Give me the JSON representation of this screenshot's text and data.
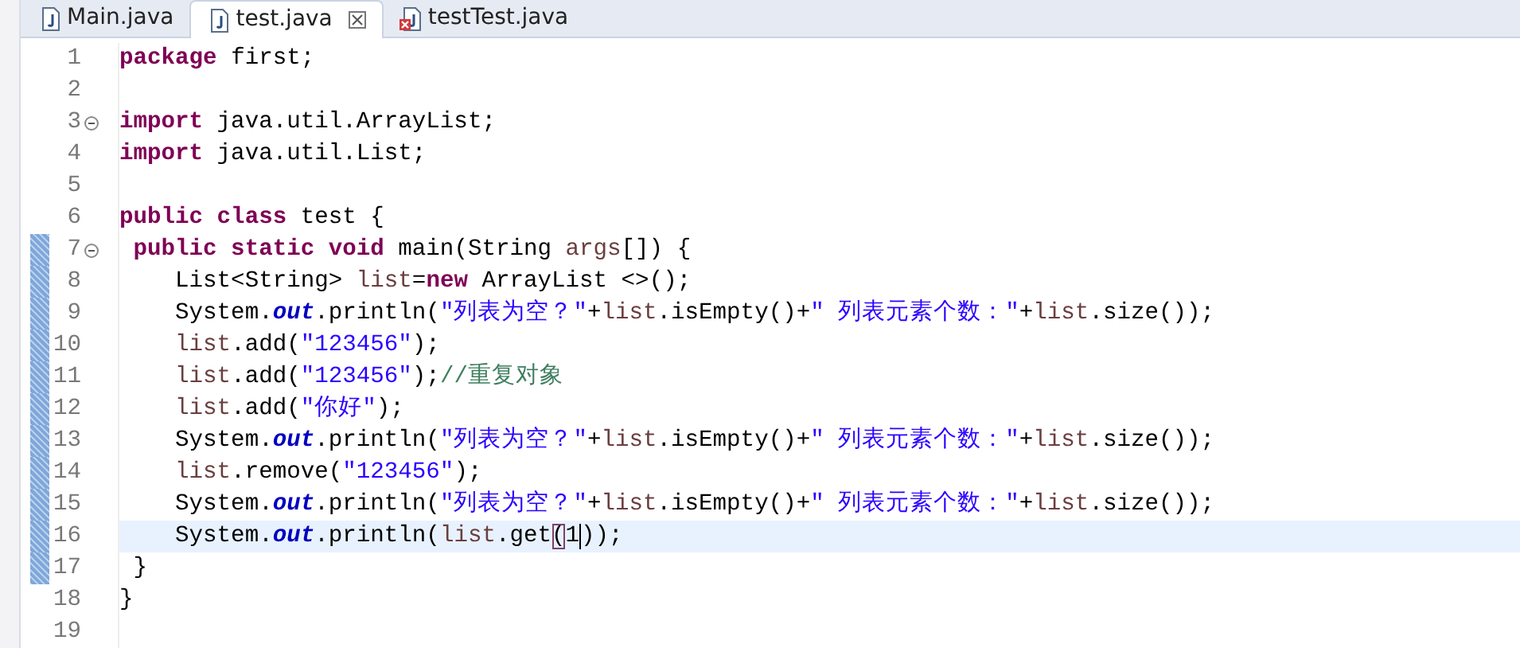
{
  "tabs": [
    {
      "label": "Main.java",
      "selected": false,
      "closable": false,
      "error": false
    },
    {
      "label": "test.java",
      "selected": true,
      "closable": true,
      "error": false
    },
    {
      "label": "testTest.java",
      "selected": false,
      "closable": false,
      "error": true
    }
  ],
  "lines": [
    {
      "number": "1",
      "fold": false,
      "changed": false,
      "current": false,
      "tokens": [
        {
          "kind": "kw",
          "text": "package"
        },
        {
          "kind": "plain",
          "text": " first;"
        }
      ]
    },
    {
      "number": "2",
      "fold": false,
      "changed": false,
      "current": false
    },
    {
      "number": "3",
      "fold": true,
      "changed": false,
      "current": false,
      "tokens": [
        {
          "kind": "kw",
          "text": "import"
        },
        {
          "kind": "plain",
          "text": " java.util.ArrayList;"
        }
      ]
    },
    {
      "number": "4",
      "fold": false,
      "changed": false,
      "current": false,
      "tokens": [
        {
          "kind": "kw",
          "text": "import"
        },
        {
          "kind": "plain",
          "text": " java.util.List;"
        }
      ]
    },
    {
      "number": "5",
      "fold": false,
      "changed": false,
      "current": false
    },
    {
      "number": "6",
      "fold": false,
      "changed": false,
      "current": false,
      "tokens": [
        {
          "kind": "kw",
          "text": "public class"
        },
        {
          "kind": "plain",
          "text": " test {"
        }
      ]
    },
    {
      "number": "7",
      "fold": true,
      "changed": true,
      "current": false,
      "tokens": [
        {
          "kind": "kw",
          "text": " public static void"
        },
        {
          "kind": "plain",
          "text": " main(String "
        },
        {
          "kind": "var",
          "text": "args"
        },
        {
          "kind": "plain",
          "text": "[]) {"
        }
      ]
    },
    {
      "number": "8",
      "fold": false,
      "changed": true,
      "current": false,
      "tokens": [
        {
          "kind": "plain",
          "text": "    List<String> "
        },
        {
          "kind": "var",
          "text": "list"
        },
        {
          "kind": "plain",
          "text": "="
        },
        {
          "kind": "kw",
          "text": "new"
        },
        {
          "kind": "plain",
          "text": " ArrayList <>();"
        }
      ]
    },
    {
      "number": "9",
      "fold": false,
      "changed": true,
      "current": false,
      "tokens": [
        {
          "kind": "plain",
          "text": "    System."
        },
        {
          "kind": "field",
          "text": "out"
        },
        {
          "kind": "plain",
          "text": ".println("
        },
        {
          "kind": "str",
          "text": "\"列表为空？\""
        },
        {
          "kind": "plain",
          "text": "+"
        },
        {
          "kind": "var",
          "text": "list"
        },
        {
          "kind": "plain",
          "text": ".isEmpty()+"
        },
        {
          "kind": "str",
          "text": "\" 列表元素个数：\""
        },
        {
          "kind": "plain",
          "text": "+"
        },
        {
          "kind": "var",
          "text": "list"
        },
        {
          "kind": "plain",
          "text": ".size());"
        }
      ]
    },
    {
      "number": "10",
      "fold": false,
      "changed": true,
      "current": false,
      "tokens": [
        {
          "kind": "var",
          "text": "    list"
        },
        {
          "kind": "plain",
          "text": ".add("
        },
        {
          "kind": "str",
          "text": "\"123456\""
        },
        {
          "kind": "plain",
          "text": ");"
        }
      ]
    },
    {
      "number": "11",
      "fold": false,
      "changed": true,
      "current": false,
      "tokens": [
        {
          "kind": "var",
          "text": "    list"
        },
        {
          "kind": "plain",
          "text": ".add("
        },
        {
          "kind": "str",
          "text": "\"123456\""
        },
        {
          "kind": "plain",
          "text": ");"
        },
        {
          "kind": "comment",
          "text": "//重复对象"
        }
      ]
    },
    {
      "number": "12",
      "fold": false,
      "changed": true,
      "current": false,
      "tokens": [
        {
          "kind": "var",
          "text": "    list"
        },
        {
          "kind": "plain",
          "text": ".add("
        },
        {
          "kind": "str",
          "text": "\"你好\""
        },
        {
          "kind": "plain",
          "text": ");"
        }
      ]
    },
    {
      "number": "13",
      "fold": false,
      "changed": true,
      "current": false,
      "tokens": [
        {
          "kind": "plain",
          "text": "    System."
        },
        {
          "kind": "field",
          "text": "out"
        },
        {
          "kind": "plain",
          "text": ".println("
        },
        {
          "kind": "str",
          "text": "\"列表为空？\""
        },
        {
          "kind": "plain",
          "text": "+"
        },
        {
          "kind": "var",
          "text": "list"
        },
        {
          "kind": "plain",
          "text": ".isEmpty()+"
        },
        {
          "kind": "str",
          "text": "\" 列表元素个数：\""
        },
        {
          "kind": "plain",
          "text": "+"
        },
        {
          "kind": "var",
          "text": "list"
        },
        {
          "kind": "plain",
          "text": ".size());"
        }
      ]
    },
    {
      "number": "14",
      "fold": false,
      "changed": true,
      "current": false,
      "tokens": [
        {
          "kind": "var",
          "text": "    list"
        },
        {
          "kind": "plain",
          "text": ".remove("
        },
        {
          "kind": "str",
          "text": "\"123456\""
        },
        {
          "kind": "plain",
          "text": ");"
        }
      ]
    },
    {
      "number": "15",
      "fold": false,
      "changed": true,
      "current": false,
      "tokens": [
        {
          "kind": "plain",
          "text": "    System."
        },
        {
          "kind": "field",
          "text": "out"
        },
        {
          "kind": "plain",
          "text": ".println("
        },
        {
          "kind": "str",
          "text": "\"列表为空？\""
        },
        {
          "kind": "plain",
          "text": "+"
        },
        {
          "kind": "var",
          "text": "list"
        },
        {
          "kind": "plain",
          "text": ".isEmpty()+"
        },
        {
          "kind": "str",
          "text": "\" 列表元素个数：\""
        },
        {
          "kind": "plain",
          "text": "+"
        },
        {
          "kind": "var",
          "text": "list"
        },
        {
          "kind": "plain",
          "text": ".size());"
        }
      ]
    },
    {
      "number": "16",
      "fold": false,
      "changed": true,
      "current": true,
      "tokens": [
        {
          "kind": "plain",
          "text": "    System."
        },
        {
          "kind": "field",
          "text": "out"
        },
        {
          "kind": "plain",
          "text": ".println("
        },
        {
          "kind": "var",
          "text": "list"
        },
        {
          "kind": "plain",
          "text": ".get"
        },
        {
          "kind": "bracket",
          "text": "("
        },
        {
          "kind": "caret",
          "text": "1"
        },
        {
          "kind": "plain",
          "text": "));"
        }
      ]
    },
    {
      "number": "17",
      "fold": false,
      "changed": true,
      "current": false,
      "tokens": [
        {
          "kind": "plain",
          "text": " }"
        }
      ]
    },
    {
      "number": "18",
      "fold": false,
      "changed": false,
      "current": false,
      "tokens": [
        {
          "kind": "plain",
          "text": "}"
        }
      ]
    },
    {
      "number": "19",
      "fold": false,
      "changed": false,
      "current": false
    }
  ]
}
